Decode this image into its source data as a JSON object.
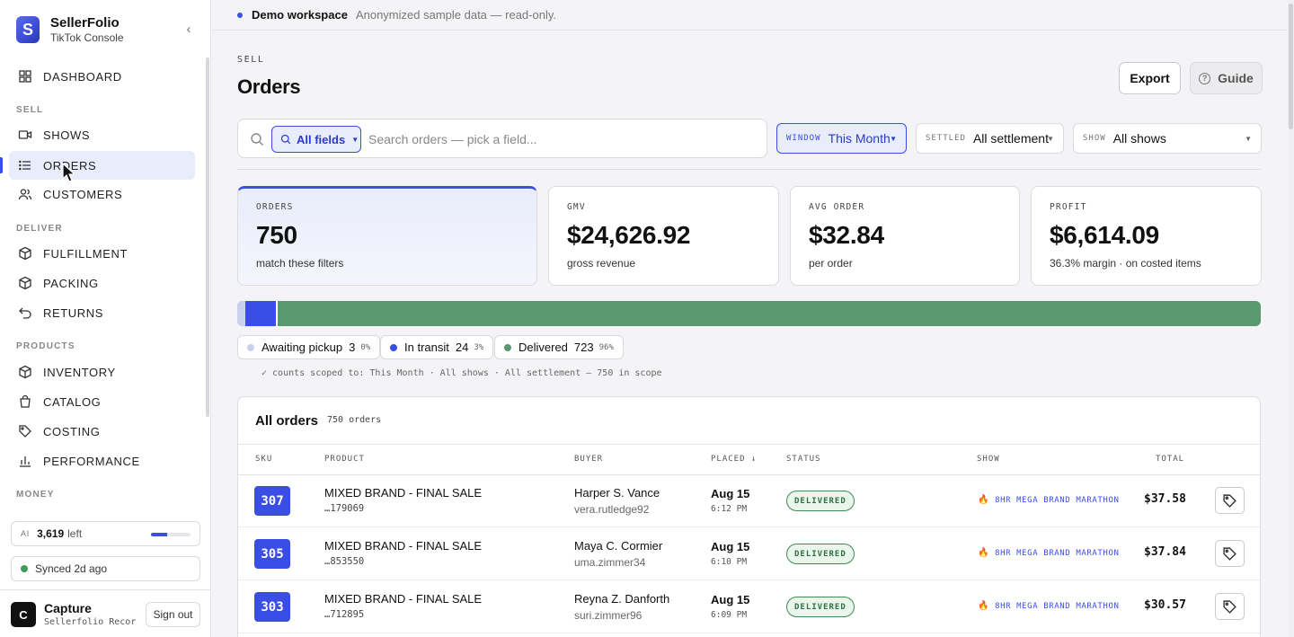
{
  "brand": {
    "name": "SellerFolio",
    "subtitle": "TikTok Console"
  },
  "sidebar": {
    "sections": {
      "sell": "SELL",
      "deliver": "DELIVER",
      "products": "PRODUCTS",
      "money": "MONEY"
    },
    "items": [
      {
        "label": "DASHBOARD",
        "icon": "grid-icon"
      },
      {
        "label": "SHOWS",
        "icon": "video-icon"
      },
      {
        "label": "ORDERS",
        "icon": "list-icon",
        "active": true
      },
      {
        "label": "CUSTOMERS",
        "icon": "users-icon"
      },
      {
        "label": "FULFILLMENT",
        "icon": "box-icon"
      },
      {
        "label": "PACKING",
        "icon": "box-icon"
      },
      {
        "label": "RETURNS",
        "icon": "return-icon"
      },
      {
        "label": "INVENTORY",
        "icon": "box-icon"
      },
      {
        "label": "CATALOG",
        "icon": "bag-icon"
      },
      {
        "label": "COSTING",
        "icon": "tag-icon"
      },
      {
        "label": "PERFORMANCE",
        "icon": "bar-chart-icon"
      }
    ],
    "ai": {
      "tag": "AI",
      "value": "3,619",
      "suffix": "left",
      "fraction": 0.4
    },
    "sync": {
      "label": "Synced 2d ago",
      "color": "#3f9b5a"
    },
    "user": {
      "initial": "C",
      "name": "Capture",
      "subtitle": "Sellerfolio Recor…",
      "signout": "Sign out"
    }
  },
  "demo": {
    "title": "Demo workspace",
    "subtitle": "Anonymized sample data — read-only."
  },
  "page": {
    "eyebrow": "SELL",
    "title": "Orders",
    "export_label": "Export",
    "guide_label": "Guide"
  },
  "search": {
    "field_label": "All fields",
    "placeholder": "Search orders — pick a field..."
  },
  "filters": {
    "window": {
      "tag": "WINDOW",
      "value": "This Month"
    },
    "settled": {
      "tag": "SETTLED",
      "value": "All settlement"
    },
    "show": {
      "tag": "SHOW",
      "value": "All shows"
    }
  },
  "kpis": [
    {
      "label": "ORDERS",
      "value": "750",
      "sub": "match these filters"
    },
    {
      "label": "GMV",
      "value": "$24,626.92",
      "sub": "gross revenue"
    },
    {
      "label": "AVG ORDER",
      "value": "$32.84",
      "sub": "per order"
    },
    {
      "label": "PROFIT",
      "value": "$6,614.09",
      "sub": "36.3% margin · on costed items"
    }
  ],
  "status_breakdown": {
    "segments": [
      {
        "name": "Awaiting pickup",
        "count": "3",
        "pct": "0%",
        "share": 0.004,
        "color": "#c9d0f0"
      },
      {
        "name": "In transit",
        "count": "24",
        "pct": "3%",
        "share": 0.032,
        "color": "#3a4ee6"
      },
      {
        "name": "Delivered",
        "count": "723",
        "pct": "96%",
        "share": 0.964,
        "color": "#5a9870"
      }
    ],
    "note": "✓ counts scoped to: This Month · All shows · All settlement — 750 in scope"
  },
  "table": {
    "title": "All orders",
    "count": "750 orders",
    "columns": {
      "sku": "SKU",
      "product": "PRODUCT",
      "buyer": "BUYER",
      "placed": "PLACED ↓",
      "status": "STATUS",
      "show": "SHOW",
      "total": "TOTAL"
    },
    "rows": [
      {
        "sku": "307",
        "product": "MIXED BRAND - FINAL SALE",
        "product_id": "…179069",
        "buyer": "Harper S. Vance",
        "handle": "vera.rutledge92",
        "date": "Aug 15",
        "time": "6:12 PM",
        "status": "DELIVERED",
        "show": "8HR MEGA BRAND MARATHON",
        "total": "$37.58"
      },
      {
        "sku": "305",
        "product": "MIXED BRAND - FINAL SALE",
        "product_id": "…853550",
        "buyer": "Maya C. Cormier",
        "handle": "uma.zimmer34",
        "date": "Aug 15",
        "time": "6:10 PM",
        "status": "DELIVERED",
        "show": "8HR MEGA BRAND MARATHON",
        "total": "$37.84"
      },
      {
        "sku": "303",
        "product": "MIXED BRAND - FINAL SALE",
        "product_id": "…712895",
        "buyer": "Reyna Z. Danforth",
        "handle": "suri.zimmer96",
        "date": "Aug 15",
        "time": "6:09 PM",
        "status": "DELIVERED",
        "show": "8HR MEGA BRAND MARATHON",
        "total": "$30.57"
      }
    ]
  }
}
